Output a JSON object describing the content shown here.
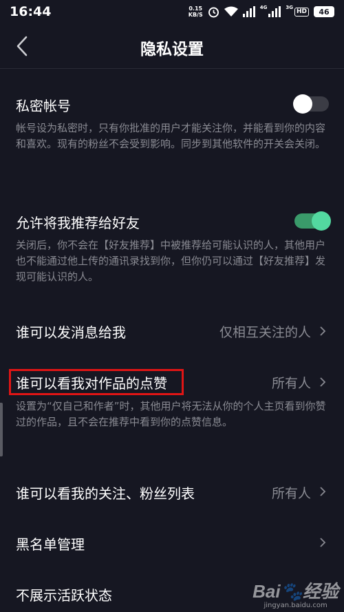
{
  "status_bar": {
    "time": "16:44",
    "net_speed_value": "0.15",
    "net_speed_unit": "KB/S",
    "sig1_label": "4G",
    "sig2_label": "3G",
    "hd_label": "HD",
    "battery": "46"
  },
  "header": {
    "title": "隐私设置"
  },
  "settings": {
    "private_account": {
      "title": "私密帐号",
      "description": "帐号设为私密时，只有你批准的用户才能关注你，并能看到你的内容和喜欢。现有的粉丝不会受到影响。同步到其他软件的开关会关闭。",
      "enabled": false
    },
    "recommend_friends": {
      "title": "允许将我推荐给好友",
      "description": "关闭后，你不会在【好友推荐】中被推荐给可能认识的人，其他用户也不能通过他上传的通讯录找到你，但你仍可以通过【好友推荐】发现可能认识的人。",
      "enabled": true
    },
    "who_can_message": {
      "title": "谁可以发消息给我",
      "value": "仅相互关注的人"
    },
    "who_can_see_likes": {
      "title": "谁可以看我对作品的点赞",
      "value": "所有人",
      "description": "设置为“仅自己和作者”时，其他用户将无法从你的个人主页看到你赞过的作品，且不会在推荐中看到你的点赞信息。"
    },
    "who_can_see_follow": {
      "title": "谁可以看我的关注、粉丝列表",
      "value": "所有人"
    },
    "blacklist": {
      "title": "黑名单管理"
    },
    "hide_active_status": {
      "title": "不展示活跃状态"
    }
  },
  "watermark": {
    "logo": "Bai🐾经验",
    "url": "jingyan.baidu.com"
  },
  "colors": {
    "background": "#161722",
    "toggle_on": "#53d9a0",
    "highlight": "#e01515",
    "secondary_text": "#8a8b93"
  }
}
